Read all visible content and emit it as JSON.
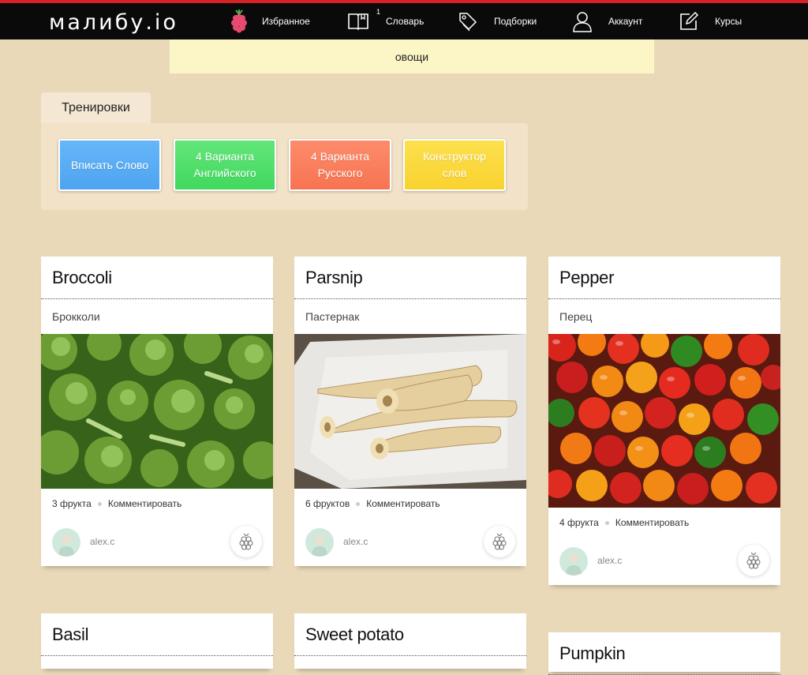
{
  "header": {
    "logo": "малибу.io",
    "nav": [
      {
        "label": "Избранное",
        "icon": "raspberry-icon"
      },
      {
        "label": "Словарь",
        "icon": "book-icon",
        "badge": "1"
      },
      {
        "label": "Подборки",
        "icon": "tag-icon"
      },
      {
        "label": "Аккаунт",
        "icon": "user-icon"
      },
      {
        "label": "Курсы",
        "icon": "edit-icon"
      }
    ]
  },
  "category": "овощи",
  "training": {
    "tab_label": "Тренировки",
    "buttons": [
      {
        "label": "Вписать Слово",
        "color": "#5aaef4"
      },
      {
        "label": "4 Варианта Английского",
        "color": "#4fe06a"
      },
      {
        "label": "4 Варианта Русского",
        "color": "#fb7e5c"
      },
      {
        "label": "Конструктор слов",
        "color": "#fbd93b"
      }
    ]
  },
  "cards": [
    {
      "title": "Broccoli",
      "translation": "Брокколи",
      "count": "3 фрукта",
      "comment": "Комментировать",
      "user": "alex.c",
      "image": "broccoli"
    },
    {
      "title": "Parsnip",
      "translation": "Пастернак",
      "count": "6 фруктов",
      "comment": "Комментировать",
      "user": "alex.c",
      "image": "parsnip"
    },
    {
      "title": "Pepper",
      "translation": "Перец",
      "count": "4 фрукта",
      "comment": "Комментировать",
      "user": "alex.c",
      "image": "peppers"
    },
    {
      "title": "Basil"
    },
    {
      "title": "Sweet potato"
    },
    {
      "title": "Pumpkin"
    }
  ]
}
